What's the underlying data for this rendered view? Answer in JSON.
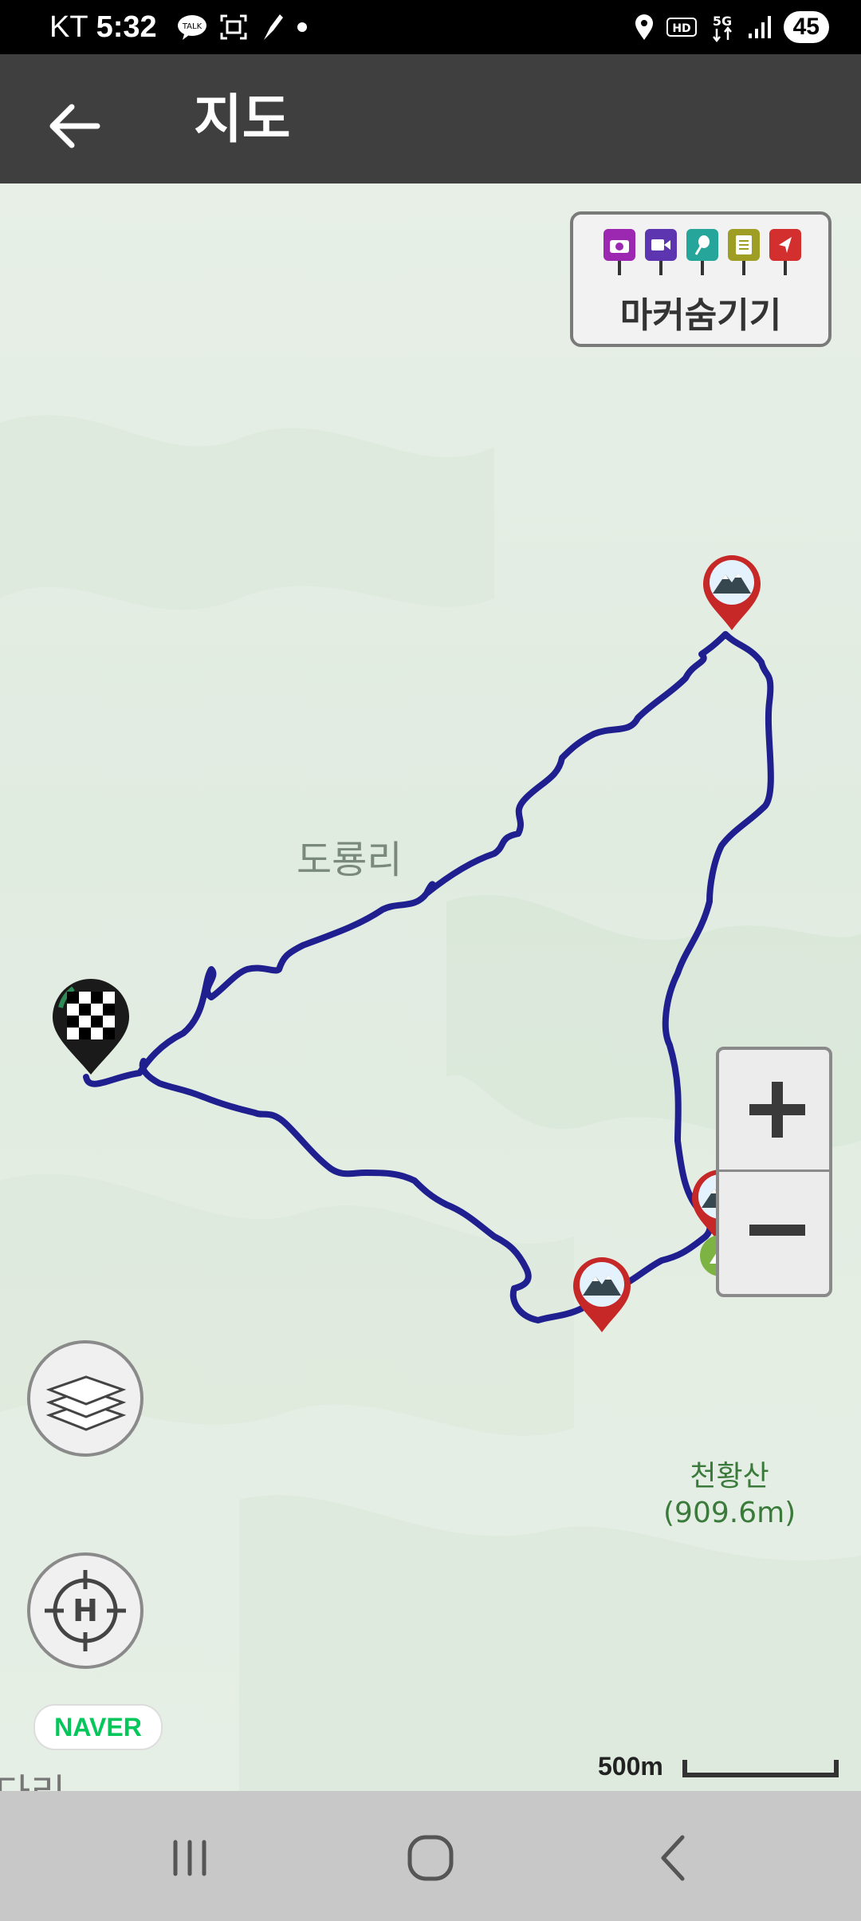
{
  "status_bar": {
    "carrier": "KT",
    "time": "5:32",
    "notification_icons": [
      "talk-icon",
      "screenshot-icon",
      "brush-app-icon",
      "dot-icon"
    ],
    "system_icons": [
      "location-icon",
      "hd-icon",
      "5g-icon",
      "signal-icon"
    ],
    "battery": "45"
  },
  "app_bar": {
    "back_icon": "arrow-left-icon",
    "title": "지도"
  },
  "map": {
    "places": [
      "도룡리",
      "다리"
    ],
    "peak": {
      "name": "천황산",
      "elevation": "(909.6m)"
    },
    "marker_toggle": {
      "label": "마커숨기기",
      "icons": [
        {
          "name": "camera-pin-icon",
          "color": "#9c27b0"
        },
        {
          "name": "video-pin-icon",
          "color": "#5e35b1"
        },
        {
          "name": "microphone-pin-icon",
          "color": "#26a69a"
        },
        {
          "name": "memo-pin-icon",
          "color": "#9e9d24"
        },
        {
          "name": "direction-pin-icon",
          "color": "#d32f2f"
        }
      ]
    },
    "zoom": {
      "in": "+",
      "out": "−"
    },
    "layers_icon": "layers-icon",
    "home_icon": "crosshair-home-icon",
    "attribution": "NAVER",
    "scale_label": "500m",
    "route_color": "#1f1f8f",
    "markers": [
      "start-flag-marker",
      "summit-marker",
      "summit-marker",
      "summit-marker"
    ]
  },
  "nav_bar": {
    "buttons": [
      "recent-apps-icon",
      "home-icon",
      "back-icon"
    ]
  }
}
